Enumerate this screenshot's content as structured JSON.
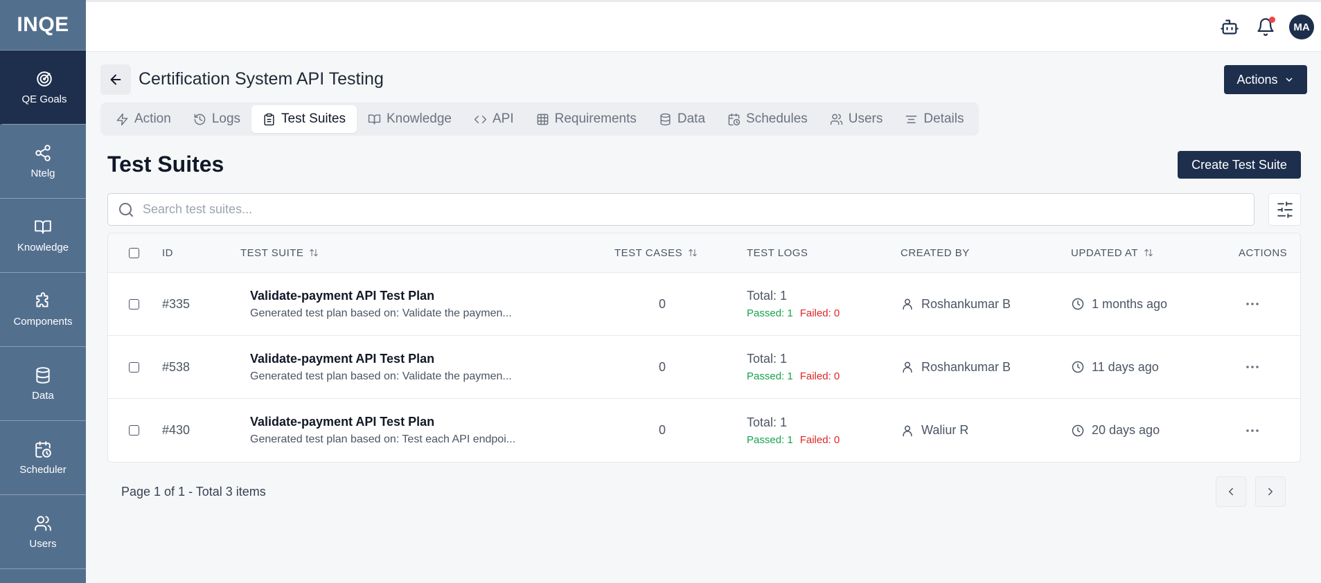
{
  "app": {
    "brand": "INQE"
  },
  "sidebar": {
    "items": [
      {
        "label": "QE Goals",
        "icon": "target-icon",
        "active": true
      },
      {
        "label": "Ntelg",
        "icon": "share-icon"
      },
      {
        "label": "Knowledge",
        "icon": "book-open-icon"
      },
      {
        "label": "Components",
        "icon": "puzzle-icon"
      },
      {
        "label": "Data",
        "icon": "database-icon"
      },
      {
        "label": "Scheduler",
        "icon": "calendar-clock-icon"
      },
      {
        "label": "Users",
        "icon": "users-icon"
      }
    ]
  },
  "topbar": {
    "avatar_initials": "MA"
  },
  "header": {
    "title": "Certification System API Testing",
    "actions_label": "Actions"
  },
  "tabs": [
    {
      "label": "Action",
      "icon": "zap-icon"
    },
    {
      "label": "Logs",
      "icon": "history-icon"
    },
    {
      "label": "Test Suites",
      "icon": "clipboard-icon",
      "active": true
    },
    {
      "label": "Knowledge",
      "icon": "book-open-icon"
    },
    {
      "label": "API",
      "icon": "code-icon"
    },
    {
      "label": "Requirements",
      "icon": "table-icon"
    },
    {
      "label": "Data",
      "icon": "database-icon"
    },
    {
      "label": "Schedules",
      "icon": "calendar-clock-icon"
    },
    {
      "label": "Users",
      "icon": "users-icon"
    },
    {
      "label": "Details",
      "icon": "list-icon"
    }
  ],
  "section": {
    "title": "Test Suites",
    "create_label": "Create Test Suite",
    "search_placeholder": "Search test suites..."
  },
  "table": {
    "columns": {
      "id": "ID",
      "suite": "TEST SUITE",
      "cases": "TEST CASES",
      "logs": "TEST LOGS",
      "created_by": "CREATED BY",
      "updated_at": "UPDATED AT",
      "actions": "ACTIONS"
    },
    "rows": [
      {
        "id": "#335",
        "name": "Validate-payment API Test Plan",
        "desc": "Generated test plan based on: Validate the paymen...",
        "cases": "0",
        "total": "Total: 1",
        "passed": "Passed: 1",
        "failed": "Failed: 0",
        "created_by": "Roshankumar B",
        "updated": "1 months ago"
      },
      {
        "id": "#538",
        "name": "Validate-payment API Test Plan",
        "desc": "Generated test plan based on: Validate the paymen...",
        "cases": "0",
        "total": "Total: 1",
        "passed": "Passed: 1",
        "failed": "Failed: 0",
        "created_by": "Roshankumar B",
        "updated": "11 days ago"
      },
      {
        "id": "#430",
        "name": "Validate-payment API Test Plan",
        "desc": "Generated test plan based on: Test each API endpoi...",
        "cases": "0",
        "total": "Total: 1",
        "passed": "Passed: 1",
        "failed": "Failed: 0",
        "created_by": "Waliur R",
        "updated": "20 days ago"
      }
    ]
  },
  "pagination": {
    "text": "Page 1 of 1 - Total 3 items"
  }
}
